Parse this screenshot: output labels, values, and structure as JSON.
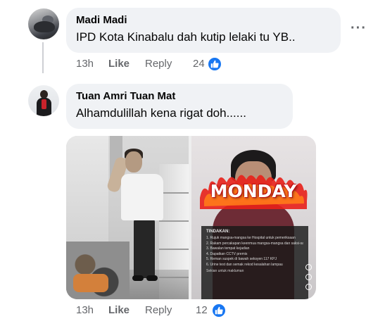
{
  "comments": [
    {
      "author": "Madi Madi",
      "text": "IPD Kota Kinabalu dah kutip lelaki tu YB..",
      "time": "13h",
      "like_label": "Like",
      "reply_label": "Reply",
      "reaction_count": "24",
      "reaction_icon": "thumbs-up-icon"
    },
    {
      "author": "Tuan Amri Tuan Mat",
      "text": "Alhamdulillah kena rigat doh......",
      "time": "13h",
      "like_label": "Like",
      "reply_label": "Reply",
      "reaction_count": "12",
      "reaction_icon": "thumbs-up-icon",
      "attachment": {
        "right_image": {
          "banner_text": "MONDAY",
          "panel_title": "TINDAKAN:",
          "panel_items": [
            "1. Rujuk mangsa-mangsa ke Hospital untuk pemeriksaan",
            "2. Rakam percakapan keenmua mangsa-mangsa dan saksi-saksi",
            "3. Bawalan tempat kejadian",
            "4. Dapatkan CCTV premis",
            "5. Reman suspek di bawah seksyen 117 KPJ",
            "6. Urine test dan semak rekod kesalahan lampau"
          ],
          "panel_footer": "Sekian untuk makluman"
        }
      }
    }
  ],
  "menu": {
    "more_label": "···"
  },
  "colors": {
    "bubble_bg": "#f0f2f5",
    "secondary_text": "#65676b",
    "reaction_blue": "#1877f2",
    "banner_red": "#d01010"
  }
}
